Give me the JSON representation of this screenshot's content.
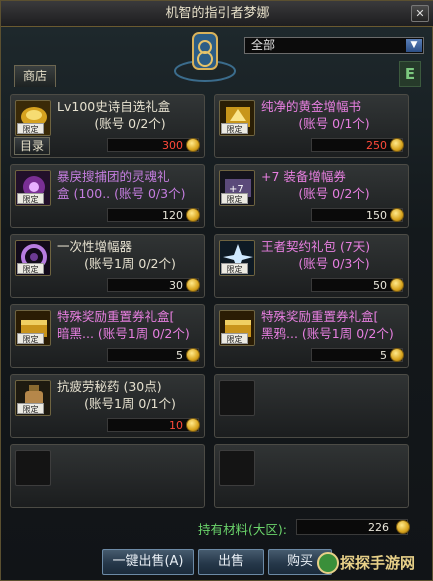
{
  "window": {
    "title": "机智的指引者梦娜",
    "close_label": "✕"
  },
  "filter": {
    "selected": "全部"
  },
  "tabs": {
    "shop": "商店"
  },
  "side_tab": "E",
  "catalog_label": "目录",
  "limit_tag": "限定",
  "items": [
    {
      "name": "Lv100史诗自选礼盒",
      "sub": "(账号 0/2个)",
      "price": "300",
      "price_red": true,
      "name_color": "white",
      "icon": "gold-box-icon"
    },
    {
      "name": "纯净的黄金增幅书",
      "sub": "(账号 0/1个)",
      "price": "250",
      "price_red": true,
      "name_color": "pink",
      "icon": "gold-book-icon"
    },
    {
      "name": "暴戾搜捕团的灵魂礼",
      "sub": "盒 (100.. (账号 0/3个)",
      "price": "120",
      "price_red": false,
      "name_color": "purple",
      "icon": "purple-soul-icon"
    },
    {
      "name": "+7 装备增幅券",
      "sub": "(账号 0/2个)",
      "price": "150",
      "price_red": false,
      "name_color": "pink",
      "icon": "amplify-ticket-icon"
    },
    {
      "name": "一次性增幅器",
      "sub": "(账号1周 0/2个)",
      "price": "30",
      "price_red": false,
      "name_color": "white",
      "icon": "amplifier-icon"
    },
    {
      "name": "王者契约礼包 (7天)",
      "sub": "(账号 0/3个)",
      "price": "50",
      "price_red": false,
      "name_color": "pink",
      "icon": "contract-pack-icon"
    },
    {
      "name": "特殊奖励重置券礼盒[",
      "sub": "暗黑... (账号1周 0/2个)",
      "price": "5",
      "price_red": false,
      "name_color": "pink",
      "icon": "reset-box-dark-icon"
    },
    {
      "name": "特殊奖励重置券礼盒[",
      "sub": "黑鸦... (账号1周 0/2个)",
      "price": "5",
      "price_red": false,
      "name_color": "pink",
      "icon": "reset-box-crow-icon"
    },
    {
      "name": "抗疲劳秘药 (30点)",
      "sub": "(账号1周 0/1个)",
      "price": "10",
      "price_red": true,
      "name_color": "white",
      "icon": "fatigue-potion-icon"
    }
  ],
  "materials": {
    "label": "持有材料(大区):",
    "value": "226"
  },
  "buttons": {
    "sell_all": "一键出售(A)",
    "sell": "出售",
    "buy": "购买"
  },
  "watermark": {
    "text": "探探手游网"
  },
  "colors": {
    "accent_gold": "#d9a51e",
    "price_red": "#ff4a3a",
    "material_green": "#6bd46b",
    "name_pink": "#e77fe0"
  }
}
